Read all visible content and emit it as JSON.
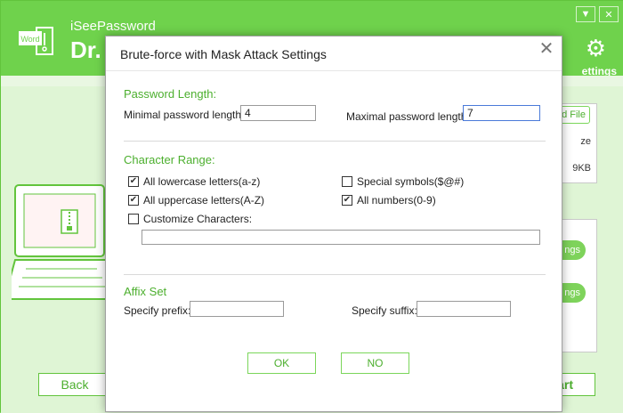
{
  "app": {
    "brand": "iSeePassword",
    "title": "Dr.",
    "logo_label": "Word",
    "settings_label": "ettings",
    "add_file_label": "d File",
    "panel_size_label": "ze",
    "panel_size_value": "9KB",
    "pill_label_1": "ngs",
    "pill_label_2": "ngs",
    "back_label": "Back",
    "start_label": "art",
    "icons": [
      "minimize-icon",
      "close-icon",
      "gear-icon",
      "word-logo-icon",
      "laptop-icon",
      "zip-file-icon"
    ]
  },
  "dialog": {
    "title": "Brute-force with Mask Attack Settings",
    "close_glyph": "✕",
    "password_length": {
      "section_title": "Password Length:",
      "min_label": "Minimal password length:",
      "min_value": "4",
      "max_label": "Maximal password length:",
      "max_value": "7"
    },
    "character_range": {
      "section_title": "Character Range:",
      "lowercase": {
        "label": "All lowercase letters(a-z)",
        "checked": true
      },
      "uppercase": {
        "label": "All uppercase letters(A-Z)",
        "checked": true
      },
      "special": {
        "label": "Special symbols($@#)",
        "checked": false
      },
      "numbers": {
        "label": "All numbers(0-9)",
        "checked": true
      },
      "customize": {
        "label": "Customize Characters:",
        "checked": false,
        "value": ""
      }
    },
    "affix": {
      "section_title": "Affix Set",
      "prefix_label": "Specify prefix:",
      "prefix_value": "",
      "suffix_label": "Specify suffix:",
      "suffix_value": ""
    },
    "ok_label": "OK",
    "no_label": "NO"
  },
  "colors": {
    "brand_green": "#6fd24c",
    "accent_green": "#4caf2e",
    "light_green": "#dff5d5"
  }
}
